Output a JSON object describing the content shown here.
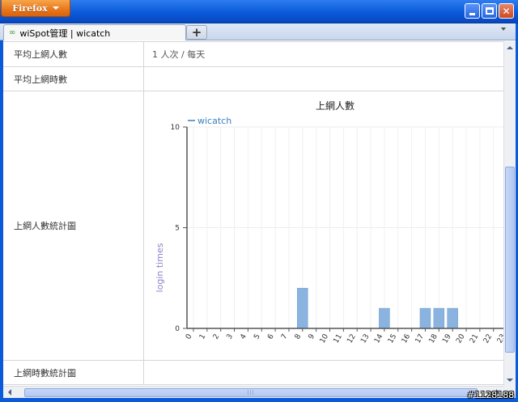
{
  "browser": {
    "menu_button_label": "Firefox",
    "tab_title": "wiSpot管理 | wicatch",
    "new_tab_label": "+"
  },
  "table": {
    "rows": [
      {
        "label": "平均上網人數",
        "value": "1 人次 / 每天"
      },
      {
        "label": "平均上網時數",
        "value": ""
      },
      {
        "label": "上網人數統計圖",
        "value": ""
      },
      {
        "label": "上網時數統計圖",
        "value": ""
      }
    ]
  },
  "chart_data": {
    "type": "bar",
    "title": "上網人數",
    "ylabel": "login times",
    "xlabel": "",
    "ylim": [
      0,
      10
    ],
    "yticks": [
      0,
      5,
      10
    ],
    "grid": true,
    "legend": "top-left",
    "categories": [
      "0",
      "1",
      "2",
      "3",
      "4",
      "5",
      "6",
      "7",
      "8",
      "9",
      "10",
      "11",
      "12",
      "13",
      "14",
      "15",
      "16",
      "17",
      "18",
      "19",
      "20",
      "21",
      "22",
      "23"
    ],
    "series": [
      {
        "name": "wicatch",
        "color": "#8ab3e0",
        "values": [
          0,
          0,
          0,
          0,
          0,
          0,
          0,
          0,
          2,
          0,
          0,
          0,
          0,
          0,
          1,
          0,
          0,
          1,
          1,
          1,
          0,
          0,
          0,
          0
        ]
      }
    ]
  },
  "watermark": "#1128188"
}
